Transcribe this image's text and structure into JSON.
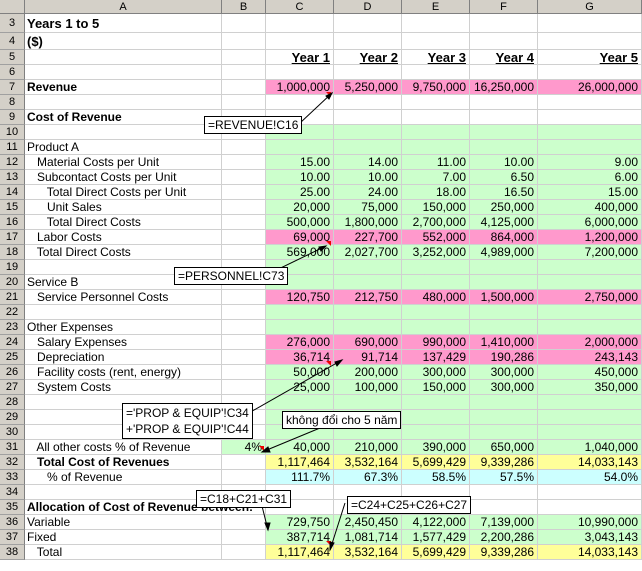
{
  "columns": [
    "A",
    "B",
    "C",
    "D",
    "E",
    "F",
    "G"
  ],
  "rows": [
    {
      "n": "3",
      "a": "Years 1 to 5",
      "bold": true,
      "big": true
    },
    {
      "n": "4",
      "a": "($)",
      "bold": true,
      "big": true
    },
    {
      "n": "5",
      "a": "",
      "hdr": [
        "Year 1",
        "Year 2",
        "Year 3",
        "Year 4",
        "Year 5"
      ]
    },
    {
      "n": "6",
      "a": ""
    },
    {
      "n": "7",
      "a": "Revenue",
      "bold": true,
      "vals": [
        "1,000,000",
        "5,250,000",
        "9,750,000",
        "16,250,000",
        "26,000,000"
      ],
      "color": "pink"
    },
    {
      "n": "8",
      "a": ""
    },
    {
      "n": "9",
      "a": "Cost of Revenue",
      "bold": true
    },
    {
      "n": "10",
      "a": "",
      "color": "green"
    },
    {
      "n": "11",
      "a": "Product A",
      "color": "green"
    },
    {
      "n": "12",
      "a": "   Material Costs per Unit",
      "vals": [
        "15.00",
        "14.00",
        "11.00",
        "10.00",
        "9.00"
      ],
      "color": "green"
    },
    {
      "n": "13",
      "a": "   Subcontact Costs per Unit",
      "vals": [
        "10.00",
        "10.00",
        "7.00",
        "6.50",
        "6.00"
      ],
      "color": "green"
    },
    {
      "n": "14",
      "a": "      Total Direct Costs per Unit",
      "vals": [
        "25.00",
        "24.00",
        "18.00",
        "16.50",
        "15.00"
      ],
      "color": "green"
    },
    {
      "n": "15",
      "a": "      Unit Sales",
      "vals": [
        "20,000",
        "75,000",
        "150,000",
        "250,000",
        "400,000"
      ],
      "color": "green"
    },
    {
      "n": "16",
      "a": "      Total Direct Costs",
      "vals": [
        "500,000",
        "1,800,000",
        "2,700,000",
        "4,125,000",
        "6,000,000"
      ],
      "color": "green"
    },
    {
      "n": "17",
      "a": "   Labor Costs",
      "vals": [
        "69,000",
        "227,700",
        "552,000",
        "864,000",
        "1,200,000"
      ],
      "color": "pink"
    },
    {
      "n": "18",
      "a": "   Total Direct Costs",
      "vals": [
        "569,000",
        "2,027,700",
        "3,252,000",
        "4,989,000",
        "7,200,000"
      ],
      "color": "green"
    },
    {
      "n": "19",
      "a": "",
      "color": "green"
    },
    {
      "n": "20",
      "a": "Service B",
      "color": "green"
    },
    {
      "n": "21",
      "a": "   Service Personnel Costs",
      "vals": [
        "120,750",
        "212,750",
        "480,000",
        "1,500,000",
        "2,750,000"
      ],
      "color": "pink"
    },
    {
      "n": "22",
      "a": "",
      "color": "green"
    },
    {
      "n": "23",
      "a": "Other Expenses",
      "color": "green"
    },
    {
      "n": "24",
      "a": "   Salary Expenses",
      "vals": [
        "276,000",
        "690,000",
        "990,000",
        "1,410,000",
        "2,000,000"
      ],
      "color": "pink"
    },
    {
      "n": "25",
      "a": "   Depreciation",
      "vals": [
        "36,714",
        "91,714",
        "137,429",
        "190,286",
        "243,143"
      ],
      "color": "pink"
    },
    {
      "n": "26",
      "a": "   Facility costs (rent, energy)",
      "vals": [
        "50,000",
        "200,000",
        "300,000",
        "300,000",
        "450,000"
      ],
      "color": "green"
    },
    {
      "n": "27",
      "a": "   System Costs",
      "vals": [
        "25,000",
        "100,000",
        "150,000",
        "300,000",
        "350,000"
      ],
      "color": "green"
    },
    {
      "n": "28",
      "a": "",
      "color": "green"
    },
    {
      "n": "29",
      "a": "",
      "color": "green"
    },
    {
      "n": "30",
      "a": "",
      "color": "green"
    },
    {
      "n": "31",
      "a": "   All other costs % of Revenue",
      "b": "4%",
      "vals": [
        "40,000",
        "210,000",
        "390,000",
        "650,000",
        "1,040,000"
      ],
      "color": "green"
    },
    {
      "n": "32",
      "a": "   Total Cost of Revenues",
      "bold": true,
      "vals": [
        "1,117,464",
        "3,532,164",
        "5,699,429",
        "9,339,286",
        "14,033,143"
      ],
      "color": "yellow"
    },
    {
      "n": "33",
      "a": "      % of Revenue",
      "vals": [
        "111.7%",
        "67.3%",
        "58.5%",
        "57.5%",
        "54.0%"
      ],
      "color": "blue"
    },
    {
      "n": "34",
      "a": ""
    },
    {
      "n": "35",
      "a": "Allocation of Cost of Revenue between:",
      "bold": true
    },
    {
      "n": "36",
      "a": "Variable",
      "vals": [
        "729,750",
        "2,450,450",
        "4,122,000",
        "7,139,000",
        "10,990,000"
      ],
      "color": "green"
    },
    {
      "n": "37",
      "a": "Fixed",
      "vals": [
        "387,714",
        "1,081,714",
        "1,577,429",
        "2,200,286",
        "3,043,143"
      ],
      "color": "green"
    },
    {
      "n": "38",
      "a": "   Total",
      "vals": [
        "1,117,464",
        "3,532,164",
        "5,699,429",
        "9,339,286",
        "14,033,143"
      ],
      "color": "yellow"
    }
  ],
  "callouts": {
    "revenue_ref": "=REVENUE!C16",
    "personnel_ref": "=PERSONNEL!C73",
    "prop_equip_ref_1": "='PROP & EQUIP'!C34",
    "prop_equip_ref_2": "+'PROP & EQUIP'!C44",
    "constant_note": "không đổi cho 5 năm",
    "fixed_sum_formula": "=C18+C21+C31",
    "variable_sum_formula": "=C24+C25+C26+C27"
  }
}
